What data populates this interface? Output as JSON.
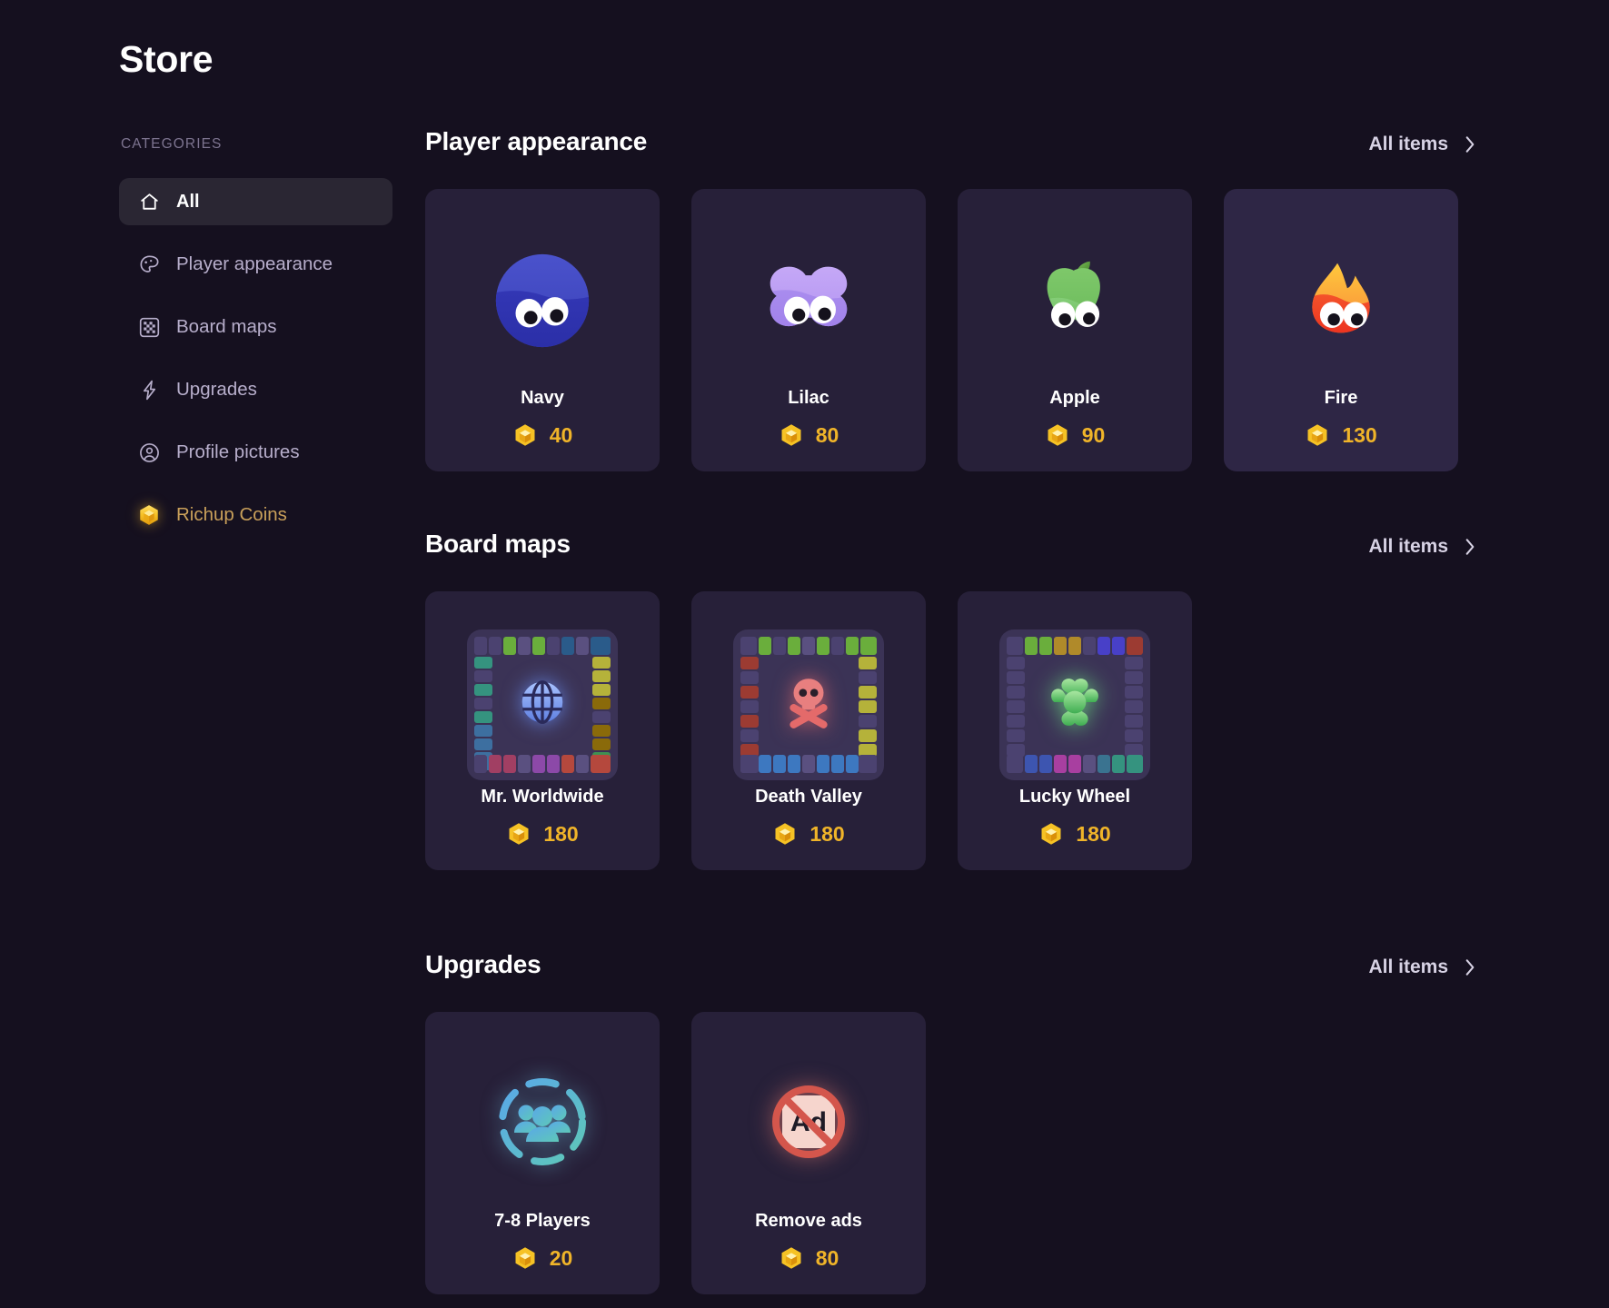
{
  "header": {
    "title": "Store"
  },
  "sidebar": {
    "heading": "CATEGORIES",
    "items": [
      {
        "label": "All",
        "icon": "home-icon",
        "active": true
      },
      {
        "label": "Player appearance",
        "icon": "palette-icon",
        "active": false
      },
      {
        "label": "Board maps",
        "icon": "checkerboard-icon",
        "active": false
      },
      {
        "label": "Upgrades",
        "icon": "lightning-bolt-icon",
        "active": false
      },
      {
        "label": "Profile pictures",
        "icon": "user-circle-icon",
        "active": false
      },
      {
        "label": "Richup Coins",
        "icon": "coin-icon",
        "active": false
      }
    ]
  },
  "all_items_label": "All items",
  "sections": [
    {
      "title": "Player appearance",
      "items": [
        {
          "name": "Navy",
          "price": "40",
          "icon": "navy-blob-icon"
        },
        {
          "name": "Lilac",
          "price": "80",
          "icon": "lilac-blob-icon"
        },
        {
          "name": "Apple",
          "price": "90",
          "icon": "apple-blob-icon"
        },
        {
          "name": "Fire",
          "price": "130",
          "icon": "fire-blob-icon"
        }
      ]
    },
    {
      "title": "Board maps",
      "items": [
        {
          "name": "Mr. Worldwide",
          "price": "180",
          "icon": "globe-icon"
        },
        {
          "name": "Death Valley",
          "price": "180",
          "icon": "skull-crossbones-icon"
        },
        {
          "name": "Lucky Wheel",
          "price": "180",
          "icon": "clover-icon"
        }
      ]
    },
    {
      "title": "Upgrades",
      "items": [
        {
          "name": "7-8 Players",
          "price": "20",
          "icon": "players-group-icon"
        },
        {
          "name": "Remove ads",
          "price": "80",
          "icon": "no-ads-icon"
        }
      ]
    }
  ],
  "colors": {
    "background": "#15101f",
    "card": "#272039",
    "card_hover": "#2e2645",
    "sidebar_active": "#2a2633",
    "coin_gold": "#f0b429",
    "muted_text": "#b7aecb",
    "heading_text": "#7d7490"
  }
}
